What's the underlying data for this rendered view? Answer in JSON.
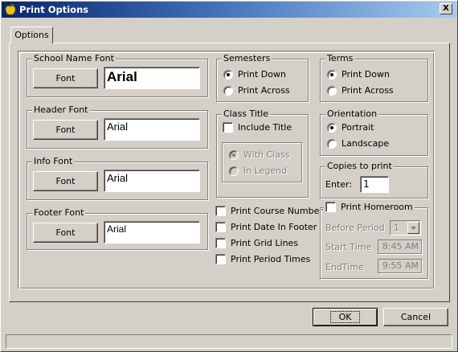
{
  "window": {
    "title": "Print Options",
    "close_label": "X"
  },
  "tab": {
    "label": "Options"
  },
  "fonts": {
    "school_name": {
      "label": "School Name Font",
      "button": "Font",
      "value": "Arial"
    },
    "header": {
      "label": "Header Font",
      "button": "Font",
      "value": "Arial"
    },
    "info": {
      "label": "Info Font",
      "button": "Font",
      "value": "Arial"
    },
    "footer": {
      "label": "Footer Font",
      "button": "Font",
      "value": "Arial"
    }
  },
  "semesters": {
    "label": "Semesters",
    "options": [
      "Print Down",
      "Print Across"
    ],
    "selected": 0
  },
  "terms": {
    "label": "Terms",
    "options": [
      "Print Down",
      "Print Across"
    ],
    "selected": 0
  },
  "class_title": {
    "label": "Class Title",
    "include_label": "Include Title",
    "include_checked": false,
    "options": [
      "With Class",
      "In Legend"
    ],
    "selected": 0
  },
  "orientation": {
    "label": "Orientation",
    "options": [
      "Portrait",
      "Landscape"
    ],
    "selected": 0
  },
  "copies": {
    "label": "Copies to print",
    "enter_label": "Enter:",
    "value": "1"
  },
  "print_options": [
    {
      "label": "Print Course Number",
      "checked": false
    },
    {
      "label": "Print Date In Footer",
      "checked": false
    },
    {
      "label": "Print Grid Lines",
      "checked": false
    },
    {
      "label": "Print Period Times",
      "checked": false
    }
  ],
  "homeroom": {
    "label": "Print Homeroom",
    "checked": false,
    "before_period_label": "Before Period",
    "before_period_value": "1",
    "start_time_label": "Start Time",
    "start_time_value": "8:45 AM",
    "end_time_label": "EndTime",
    "end_time_value": "9:55 AM"
  },
  "buttons": {
    "ok": "OK",
    "cancel": "Cancel"
  }
}
